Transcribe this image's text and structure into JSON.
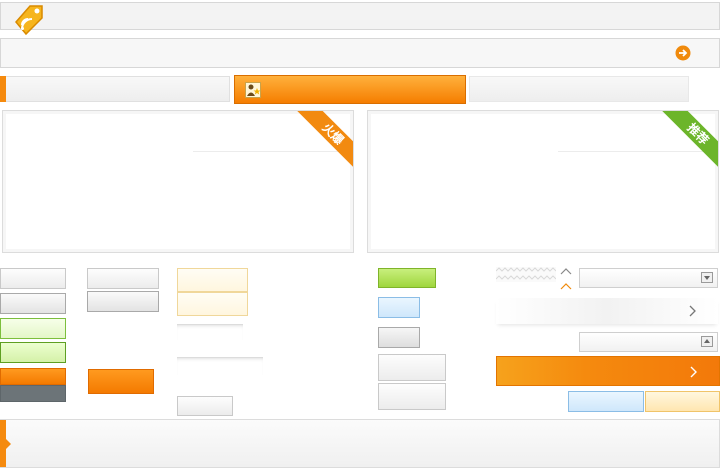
{
  "header": {
    "logo_icon": "tag-rss-icon"
  },
  "subbar": {
    "arrow_icon": "arrow-right-circle-icon",
    "accent": "#f08a0c"
  },
  "tabs": {
    "active_icon": "user-star-icon",
    "active_color": "#f58a0e"
  },
  "panels": [
    {
      "ribbon_text": "火爆",
      "ribbon_color": "#f28a10"
    },
    {
      "ribbon_text": "推荐",
      "ribbon_color": "#6cb52a"
    }
  ],
  "footer": {
    "marker_icon": "caret-right-icon"
  },
  "widgets": {
    "spinner_up_icon": "chevron-up-icon",
    "spinner_down_icon": "chevron-down-icon",
    "select_arrow_icon": "dropdown-arrow-icon",
    "row_chevron_icon": "chevron-right-icon"
  }
}
